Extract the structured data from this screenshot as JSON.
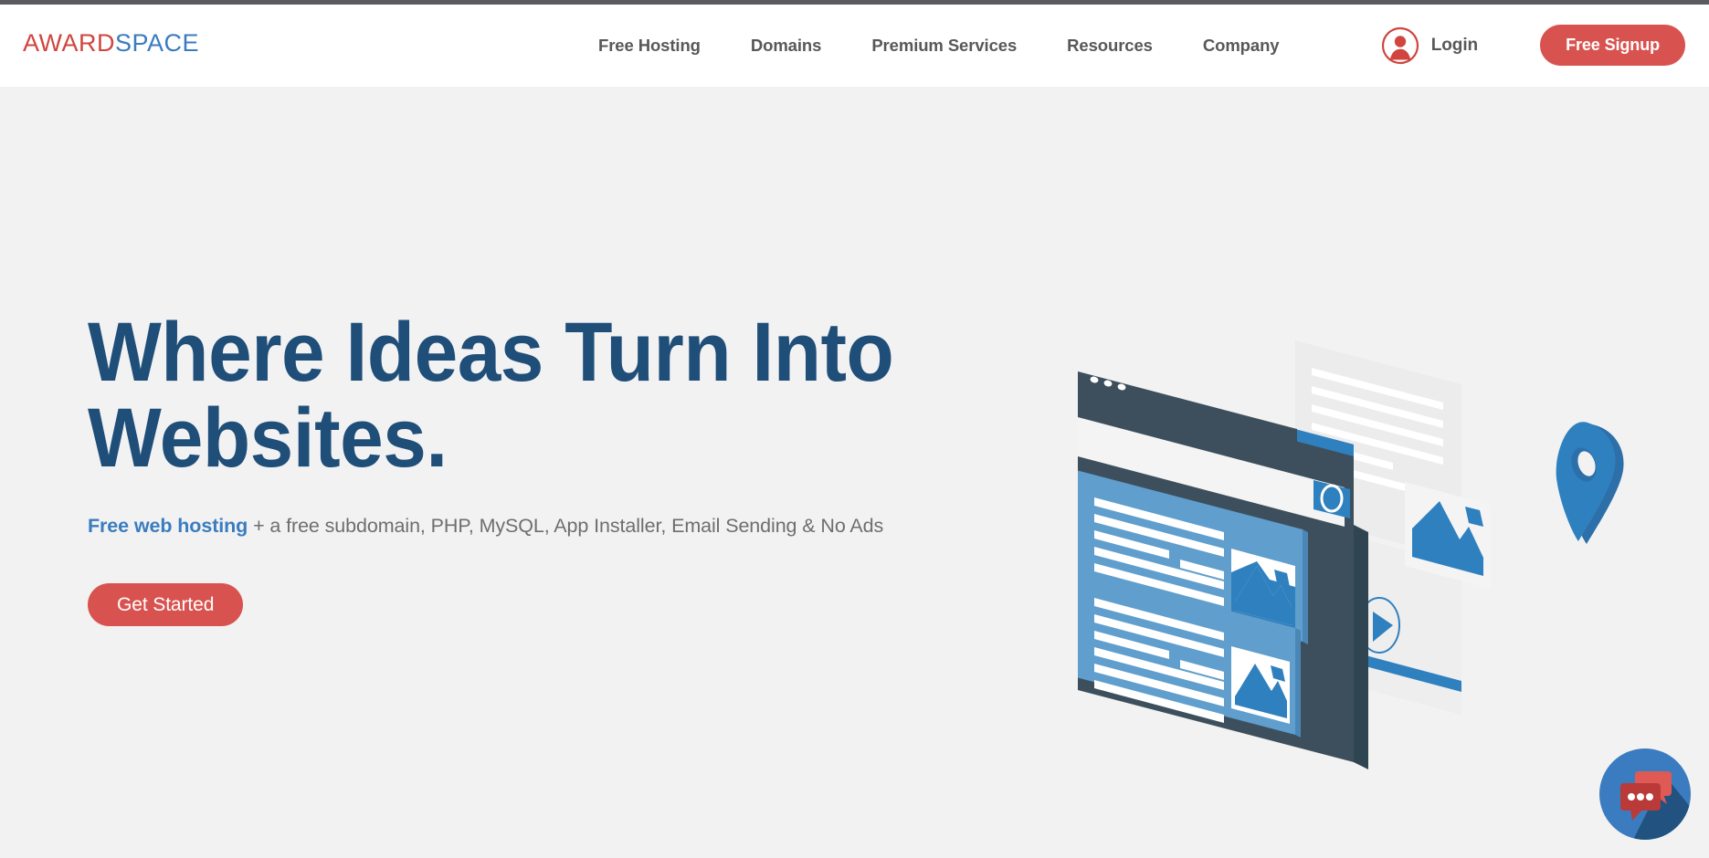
{
  "topbar": {
    "color": "#5c5a5e"
  },
  "header": {
    "logo": {
      "part1": "AWARD",
      "part2": "SPACE",
      "color1": "#d0453f",
      "color2": "#3a7cbf"
    },
    "nav": [
      {
        "label": "Free Hosting",
        "name": "nav-free-hosting"
      },
      {
        "label": "Domains",
        "name": "nav-domains"
      },
      {
        "label": "Premium Services",
        "name": "nav-premium-services"
      },
      {
        "label": "Resources",
        "name": "nav-resources"
      },
      {
        "label": "Company",
        "name": "nav-company"
      }
    ],
    "login": {
      "label": "Login",
      "icon": "user-avatar-icon",
      "icon_color": "#d0453f"
    },
    "signup": {
      "label": "Free Signup",
      "color": "#d8534f"
    }
  },
  "hero": {
    "headline": "Where Ideas Turn Into\nWebsites.",
    "headline_color": "#1f4e79",
    "subline": {
      "highlight": "Free web hosting",
      "highlight_color": "#3a7cbf",
      "rest": " + a free subdomain, PHP, MySQL, App Installer, Email Sending & No Ads",
      "rest_color": "#6e6e70"
    },
    "cta": {
      "label": "Get Started",
      "color": "#d8534f"
    },
    "background": "#f2f2f2",
    "illustration": {
      "name": "isometric-website-builder-illustration",
      "elements": [
        "browser-window",
        "content-card-top",
        "content-card-bottom",
        "image-placeholder-icon",
        "map-pin-icon",
        "video-play-icon",
        "text-lines-panel"
      ],
      "colors": {
        "dark": "#3d4f5c",
        "blue": "#2f80bf",
        "light_blue": "#5f9ecd",
        "white": "#ffffff",
        "pale": "#e9eaea"
      }
    }
  },
  "chat_widget": {
    "name": "live-chat-button",
    "circle_color": "#3a7cbf",
    "bubble_back_color": "#e05a55",
    "bubble_front_color": "#b93a39",
    "shadow_color": "#1f4e79",
    "dots": 3
  }
}
